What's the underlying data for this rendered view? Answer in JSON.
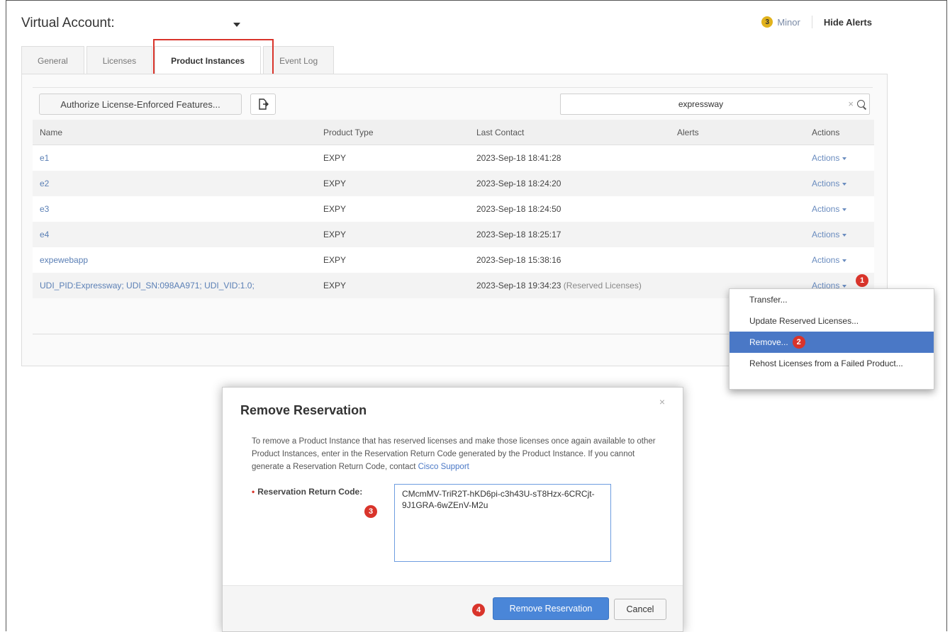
{
  "header": {
    "title": "Virtual Account:",
    "alerts": {
      "count": "3",
      "level": "Minor",
      "hide_label": "Hide Alerts"
    }
  },
  "tabs": [
    {
      "label": "General"
    },
    {
      "label": "Licenses"
    },
    {
      "label": "Product Instances",
      "active": true
    },
    {
      "label": "Event Log"
    }
  ],
  "toolbar": {
    "authorize_label": "Authorize License-Enforced Features...",
    "export_icon": "export-icon",
    "search_value": "expressway",
    "clear_glyph": "×"
  },
  "table": {
    "columns": [
      "Name",
      "Product Type",
      "Last Contact",
      "Alerts",
      "Actions"
    ],
    "rows": [
      {
        "name": "e1",
        "type": "EXPY",
        "contact": "2023-Sep-18 18:41:28",
        "note": "",
        "alerts": "",
        "action": "Actions"
      },
      {
        "name": "e2",
        "type": "EXPY",
        "contact": "2023-Sep-18 18:24:20",
        "note": "",
        "alerts": "",
        "action": "Actions"
      },
      {
        "name": "e3",
        "type": "EXPY",
        "contact": "2023-Sep-18 18:24:50",
        "note": "",
        "alerts": "",
        "action": "Actions"
      },
      {
        "name": "e4",
        "type": "EXPY",
        "contact": "2023-Sep-18 18:25:17",
        "note": "",
        "alerts": "",
        "action": "Actions"
      },
      {
        "name": "expewebapp",
        "type": "EXPY",
        "contact": "2023-Sep-18 15:38:16",
        "note": "",
        "alerts": "",
        "action": "Actions"
      },
      {
        "name": "UDI_PID:Expressway; UDI_SN:098AA971; UDI_VID:1.0;",
        "type": "EXPY",
        "contact": "2023-Sep-18 19:34:23",
        "note": "(Reserved Licenses)",
        "alerts": "",
        "action": "Actions"
      }
    ]
  },
  "dropdown": {
    "items": [
      "Transfer...",
      "Update Reserved Licenses...",
      "Remove...",
      "Rehost Licenses from a Failed Product..."
    ],
    "selected_index": 2
  },
  "steps": [
    "1",
    "2",
    "3",
    "4"
  ],
  "modal": {
    "title": "Remove Reservation",
    "close_glyph": "×",
    "description": "To remove a Product Instance that has reserved licenses and make those licenses once again available to other Product Instances, enter in the Reservation Return Code generated by the Product Instance. If you cannot generate a Reservation Return Code, contact ",
    "support_link": "Cisco Support",
    "required_mark": "•",
    "field_label": "Reservation Return Code:",
    "field_value": "CMcmMV-TriR2T-hKD6pi-c3h43U-sT8Hzx-6CRCjt-9J1GRA-6wZEnV-M2u",
    "primary_label": "Remove Reservation",
    "cancel_label": "Cancel"
  },
  "colors": {
    "accent": "#4a78c6",
    "callout": "#d9342b",
    "badge": "#e1b21c"
  }
}
